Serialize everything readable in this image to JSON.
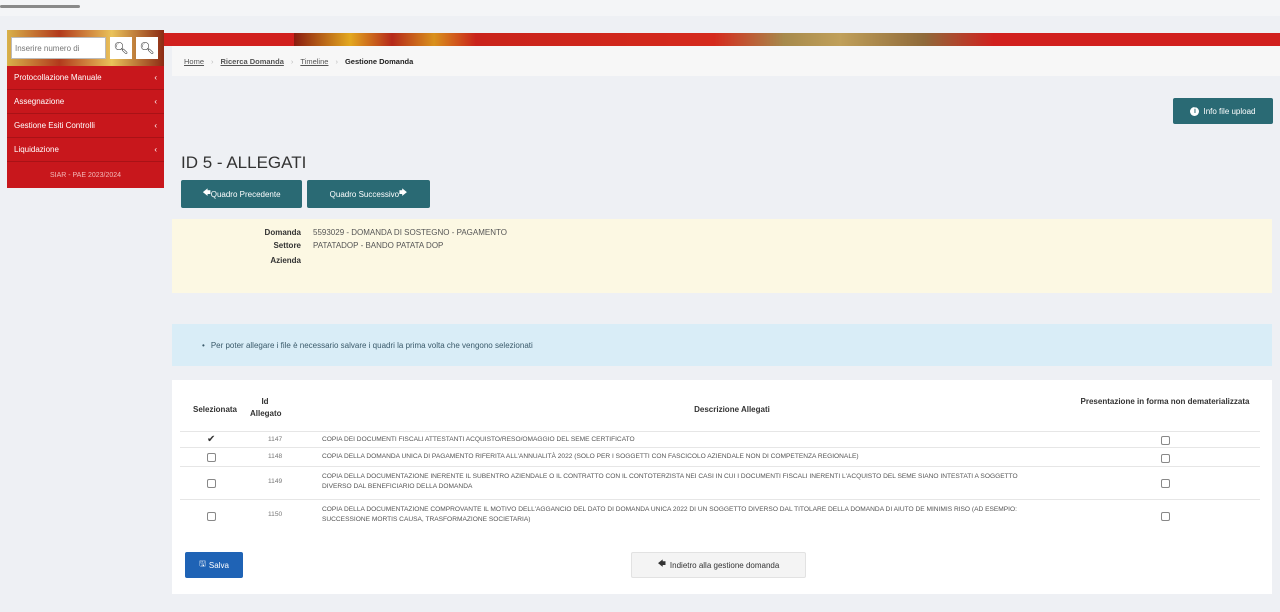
{
  "search": {
    "placeholder": "Inserire numero di",
    "icon": "search-icon"
  },
  "sidebar": {
    "items": [
      {
        "label": "Protocollazione Manuale"
      },
      {
        "label": "Assegnazione"
      },
      {
        "label": "Gestione Esiti Controlli"
      },
      {
        "label": "Liquidazione"
      }
    ],
    "footer": "SIAR - PAE 2023/2024"
  },
  "breadcrumb": {
    "home": "Home",
    "ricerca": "Ricerca Domanda",
    "timeline": "Timeline",
    "current": "Gestione Domanda"
  },
  "info_upload_label": "Info file upload",
  "page_title": "ID 5 - ALLEGATI",
  "nav": {
    "prev": "Quadro Precedente",
    "next": "Quadro Successivo"
  },
  "domanda": {
    "domanda_label": "Domanda",
    "domanda_value": "5593029 - DOMANDA DI SOSTEGNO - PAGAMENTO",
    "settore_label": "Settore",
    "settore_value": "PATATADOP - BANDO PATATA DOP",
    "azienda_label": "Azienda",
    "azienda_value": ""
  },
  "alert": "Per poter allegare i file è necessario salvare i quadri la prima volta che vengono selezionati",
  "table": {
    "headers": {
      "selezionata": "Selezionata",
      "id_allegato": "Id Allegato",
      "descrizione": "Descrizione Allegati",
      "presentazione": "Presentazione in forma non dematerializzata"
    },
    "rows": [
      {
        "selected": true,
        "id": "1147",
        "descrizione": "COPIA DEI DOCUMENTI FISCALI ATTESTANTI ACQUISTO/RESO/OMAGGIO DEL SEME CERTIFICATO"
      },
      {
        "selected": false,
        "id": "1148",
        "descrizione": "COPIA DELLA DOMANDA UNICA DI PAGAMENTO RIFERITA ALL'ANNUALITÀ 2022 (SOLO PER I SOGGETTI CON FASCICOLO AZIENDALE NON DI COMPETENZA REGIONALE)"
      },
      {
        "selected": false,
        "id": "1149",
        "descrizione": "COPIA DELLA DOCUMENTAZIONE INERENTE IL SUBENTRO AZIENDALE O IL CONTRATTO CON IL CONTOTERZISTA NEI CASI IN CUI I DOCUMENTI FISCALI INERENTI L'ACQUISTO DEL SEME SIANO INTESTATI A SOGGETTO DIVERSO DAL BENEFICIARIO DELLA DOMANDA"
      },
      {
        "selected": false,
        "id": "1150",
        "descrizione": "COPIA DELLA DOCUMENTAZIONE COMPROVANTE IL MOTIVO DELL'AGGANCIO DEL DATO DI DOMANDA UNICA 2022 DI UN SOGGETTO DIVERSO DAL TITOLARE DELLA DOMANDA DI AIUTO DE MINIMIS RISO (AD ESEMPIO: SUCCESSIONE MORTIS CAUSA, TRASFORMAZIONE SOCIETARIA)"
      }
    ]
  },
  "actions": {
    "save": "Salva",
    "back": "Indietro alla gestione domanda"
  },
  "colors": {
    "sidebar_red": "#c8171c",
    "teal": "#2a6a74",
    "blue": "#1f63b5"
  }
}
